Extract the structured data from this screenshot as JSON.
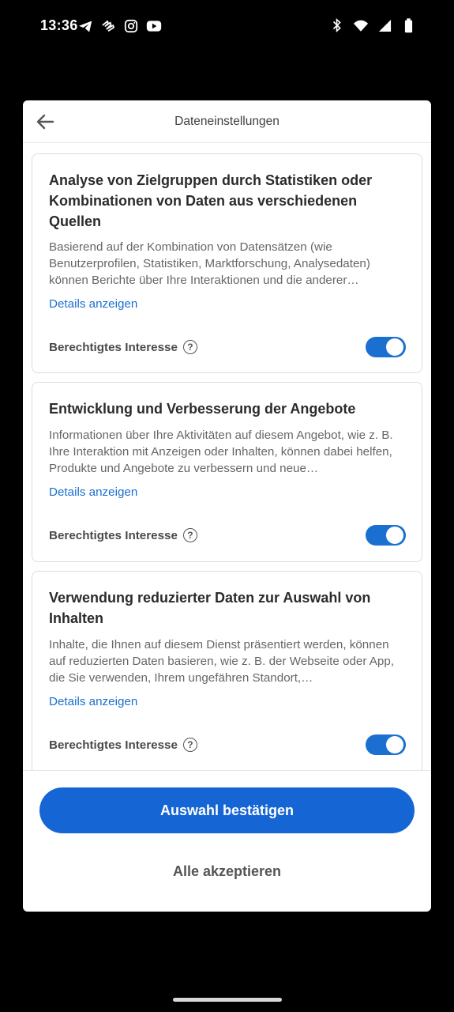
{
  "status_bar": {
    "time": "13:36",
    "left_icons": [
      "telegram-icon",
      "app-icon",
      "instagram-icon",
      "youtube-icon"
    ],
    "right_icons": [
      "bluetooth-icon",
      "wifi-icon",
      "signal-icon",
      "battery-icon"
    ]
  },
  "dialog": {
    "title": "Dateneinstellungen",
    "cards": [
      {
        "title": "Analyse von Zielgruppen durch Statistiken oder Kombinationen von Daten aus verschiedenen Quellen",
        "description": "Basierend auf der Kombination von Datensätzen (wie Benutzerprofilen, Statistiken, Marktforschung, Analysedaten) können Berichte über Ihre Interaktionen und die anderer…",
        "details_label": "Details anzeigen",
        "legit_label": "Berechtigtes Interesse",
        "toggle_on": true
      },
      {
        "title": "Entwicklung und Verbesserung der Angebote",
        "description": "Informationen über Ihre Aktivitäten auf diesem Angebot, wie z. B. Ihre Interaktion mit Anzeigen oder Inhalten, können dabei helfen, Produkte und Angebote zu verbessern und neue…",
        "details_label": "Details anzeigen",
        "legit_label": "Berechtigtes Interesse",
        "toggle_on": true
      },
      {
        "title": "Verwendung reduzierter Daten zur Auswahl von Inhalten",
        "description": "Inhalte, die Ihnen auf diesem Dienst präsentiert werden, können auf reduzierten Daten basieren, wie z. B. der Webseite oder App, die Sie verwenden, Ihrem ungefähren Standort,…",
        "details_label": "Details anzeigen",
        "legit_label": "Berechtigtes Interesse",
        "toggle_on": true
      }
    ],
    "confirm_button": "Auswahl bestätigen",
    "accept_all_button": "Alle akzeptieren"
  },
  "colors": {
    "accent": "#1565d4",
    "link": "#1a6fd0"
  }
}
